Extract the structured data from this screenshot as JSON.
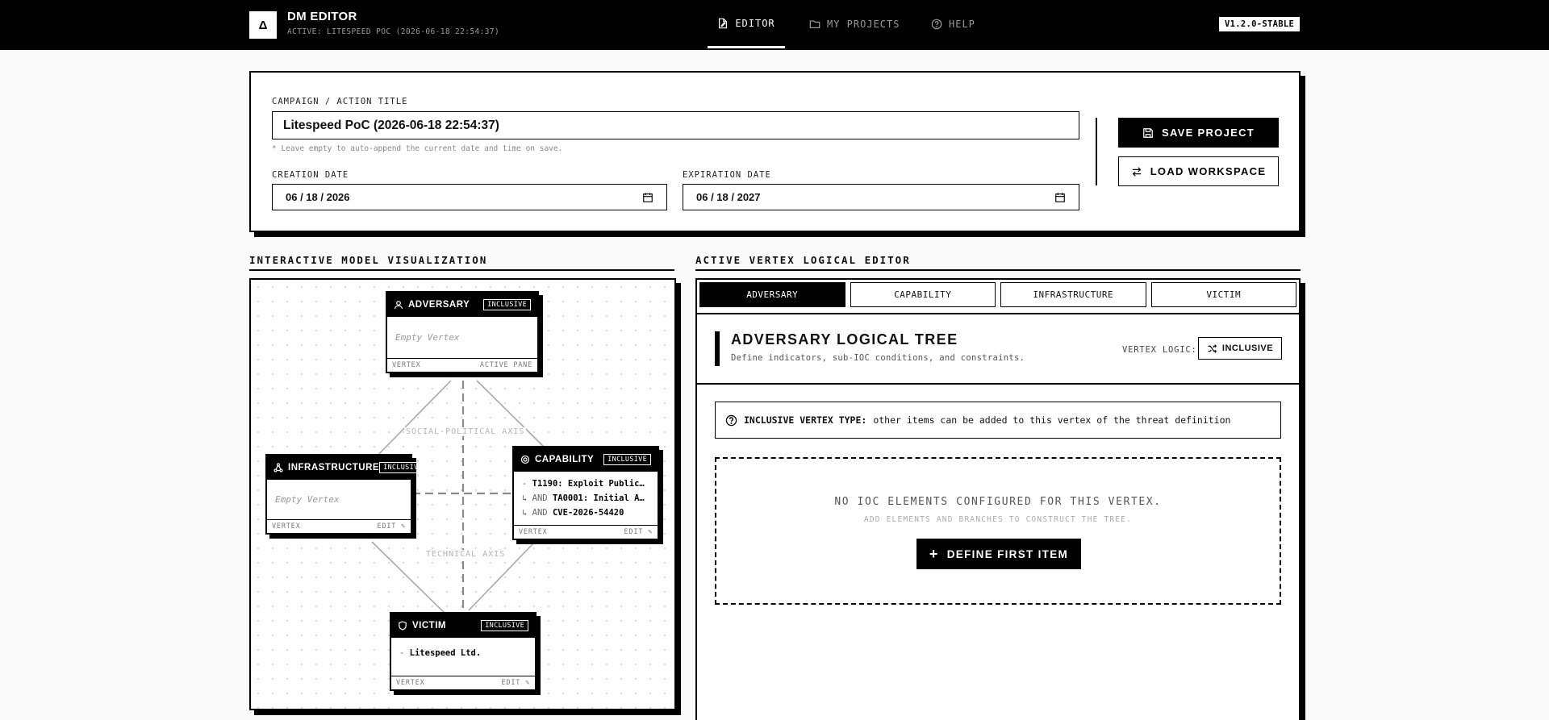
{
  "header": {
    "logo": "Δ",
    "title": "DM EDITOR",
    "subtitle": "ACTIVE: LITESPEED POC (2026-06-18 22:54:37)",
    "nav": [
      {
        "label": "EDITOR",
        "icon": "file-edit-icon",
        "active": true
      },
      {
        "label": "MY PROJECTS",
        "icon": "folder-icon",
        "active": false
      },
      {
        "label": "HELP",
        "icon": "help-circle-icon",
        "active": false
      }
    ],
    "version": "V1.2.0-STABLE"
  },
  "project": {
    "title_label": "CAMPAIGN / ACTION TITLE",
    "title_value": "Litespeed PoC (2026-06-18 22:54:37)",
    "title_hint": "* Leave empty to auto-append the current date and time on save.",
    "creation_label": "CREATION DATE",
    "creation_value": "06 / 18 / 2026",
    "expiration_label": "EXPIRATION DATE",
    "expiration_value": "06 / 18 / 2027",
    "save_label": "SAVE PROJECT",
    "load_label": "LOAD WORKSPACE"
  },
  "viz": {
    "heading": "INTERACTIVE MODEL VISUALIZATION",
    "axis_social": "SOCIAL-POLITICAL AXIS",
    "axis_technical": "TECHNICAL AXIS",
    "adversary": {
      "name": "ADVERSARY",
      "badge": "INCLUSIVE",
      "empty": "Empty Vertex",
      "foot_left": "VERTEX",
      "foot_right": "ACTIVE PANE"
    },
    "infrastructure": {
      "name": "INFRASTRUCTURE",
      "badge": "INCLUSIVE",
      "empty": "Empty Vertex",
      "foot_left": "VERTEX",
      "foot_right": "EDIT ✎"
    },
    "capability": {
      "name": "CAPABILITY",
      "badge": "INCLUSIVE",
      "items": [
        {
          "prefix": "- ",
          "text": "T1190: Exploit Public…"
        },
        {
          "prefix": "↳ AND ",
          "text": "TA0001: Initial A…"
        },
        {
          "prefix": "↳ AND ",
          "text": "CVE-2026-54420"
        }
      ],
      "foot_left": "VERTEX",
      "foot_right": "EDIT ✎"
    },
    "victim": {
      "name": "VICTIM",
      "badge": "INCLUSIVE",
      "items": [
        {
          "prefix": "- ",
          "text": "Litespeed Ltd."
        }
      ],
      "foot_left": "VERTEX",
      "foot_right": "EDIT ✎"
    }
  },
  "editor": {
    "heading": "ACTIVE VERTEX LOGICAL EDITOR",
    "tabs": [
      "ADVERSARY",
      "CAPABILITY",
      "INFRASTRUCTURE",
      "VICTIM"
    ],
    "active_tab": "ADVERSARY",
    "tree_title": "ADVERSARY LOGICAL TREE",
    "tree_subtitle": "Define indicators, sub-IOC conditions, and constraints.",
    "vertex_logic_label": "VERTEX LOGIC:",
    "vertex_logic_value": "INCLUSIVE",
    "info_strong": "INCLUSIVE VERTEX TYPE:",
    "info_text": "other items can be added to this vertex of the threat definition",
    "empty_title": "NO IOC ELEMENTS CONFIGURED FOR THIS VERTEX.",
    "empty_subtitle": "ADD ELEMENTS AND BRANCHES TO CONSTRUCT THE TREE.",
    "define_label": "DEFINE FIRST ITEM"
  }
}
